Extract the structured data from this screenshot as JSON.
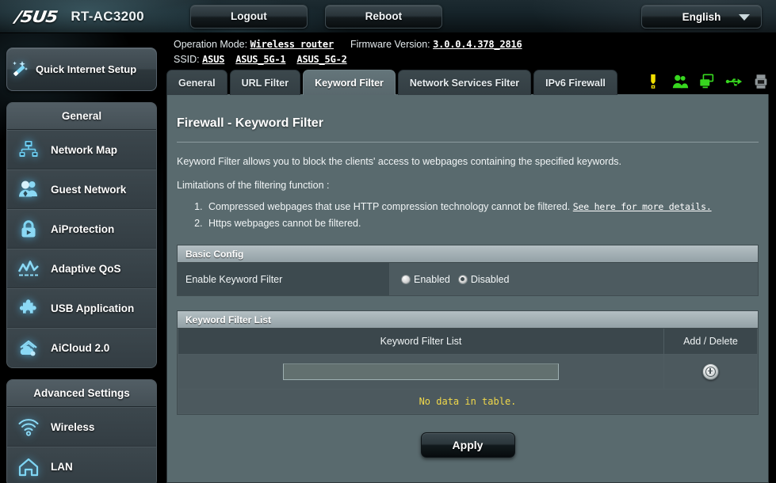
{
  "header": {
    "brand": "/5U5",
    "model": "RT-AC3200",
    "logout_label": "Logout",
    "reboot_label": "Reboot",
    "language": "English"
  },
  "info": {
    "operation_mode_label": "Operation Mode:",
    "operation_mode_value": "Wireless router",
    "firmware_label": "Firmware Version:",
    "firmware_value": "3.0.0.4.378_2816",
    "ssid_label": "SSID:",
    "ssid_values": [
      "ASUS",
      "ASUS_5G-1",
      "ASUS_5G-2"
    ],
    "status_icons": [
      {
        "name": "notification-warning-icon",
        "color": "#f2e000"
      },
      {
        "name": "guest-network-users-icon",
        "color": "#37d71f"
      },
      {
        "name": "connected-clients-monitor-icon",
        "color": "#37d71f"
      },
      {
        "name": "usb-device-icon",
        "color": "#37d71f"
      },
      {
        "name": "printer-icon",
        "color": "#8f9699"
      }
    ]
  },
  "tabs": [
    {
      "label": "General",
      "active": false
    },
    {
      "label": "URL Filter",
      "active": false
    },
    {
      "label": "Keyword Filter",
      "active": true
    },
    {
      "label": "Network Services Filter",
      "active": false
    },
    {
      "label": "IPv6 Firewall",
      "active": false
    }
  ],
  "sidebar": {
    "quick_setup": "Quick Internet Setup",
    "groups": [
      {
        "title": "General",
        "items": [
          {
            "label": "Network Map",
            "icon": "network-map-icon"
          },
          {
            "label": "Guest Network",
            "icon": "guest-network-icon"
          },
          {
            "label": "AiProtection",
            "icon": "aiprotection-lock-icon"
          },
          {
            "label": "Adaptive QoS",
            "icon": "adaptive-qos-icon"
          },
          {
            "label": "USB Application",
            "icon": "usb-application-puzzle-icon"
          },
          {
            "label": "AiCloud 2.0",
            "icon": "aicloud-icon"
          }
        ]
      },
      {
        "title": "Advanced Settings",
        "items": [
          {
            "label": "Wireless",
            "icon": "wireless-signal-icon"
          },
          {
            "label": "LAN",
            "icon": "lan-house-icon"
          }
        ]
      }
    ]
  },
  "main": {
    "title": "Firewall - Keyword Filter",
    "description": "Keyword Filter allows you to block the clients' access to webpages containing the specified keywords.",
    "limitations_intro": "Limitations of the filtering function :",
    "limitations": [
      {
        "text": "Compressed webpages that use HTTP compression technology cannot be filtered.",
        "link": "See here for more details."
      },
      {
        "text": "Https webpages cannot be filtered.",
        "link": ""
      }
    ],
    "basic_config": {
      "section_title": "Basic Config",
      "row_label": "Enable Keyword Filter",
      "options": [
        {
          "label": "Enabled",
          "selected": false
        },
        {
          "label": "Disabled",
          "selected": true
        }
      ]
    },
    "keyword_list": {
      "section_title": "Keyword Filter List",
      "columns": [
        "Keyword Filter List",
        "Add / Delete"
      ],
      "input_value": "",
      "input_placeholder": "",
      "add_icon": "add-plus-icon",
      "empty_message": "No data in table.",
      "rows": []
    },
    "apply_label": "Apply"
  },
  "colors": {
    "content_bg": "#596a6e",
    "section_header": "#93a1a6",
    "accent_cyan": "#4fc3f0",
    "warning_yellow": "#f0d84a",
    "status_green": "#37d71f"
  }
}
